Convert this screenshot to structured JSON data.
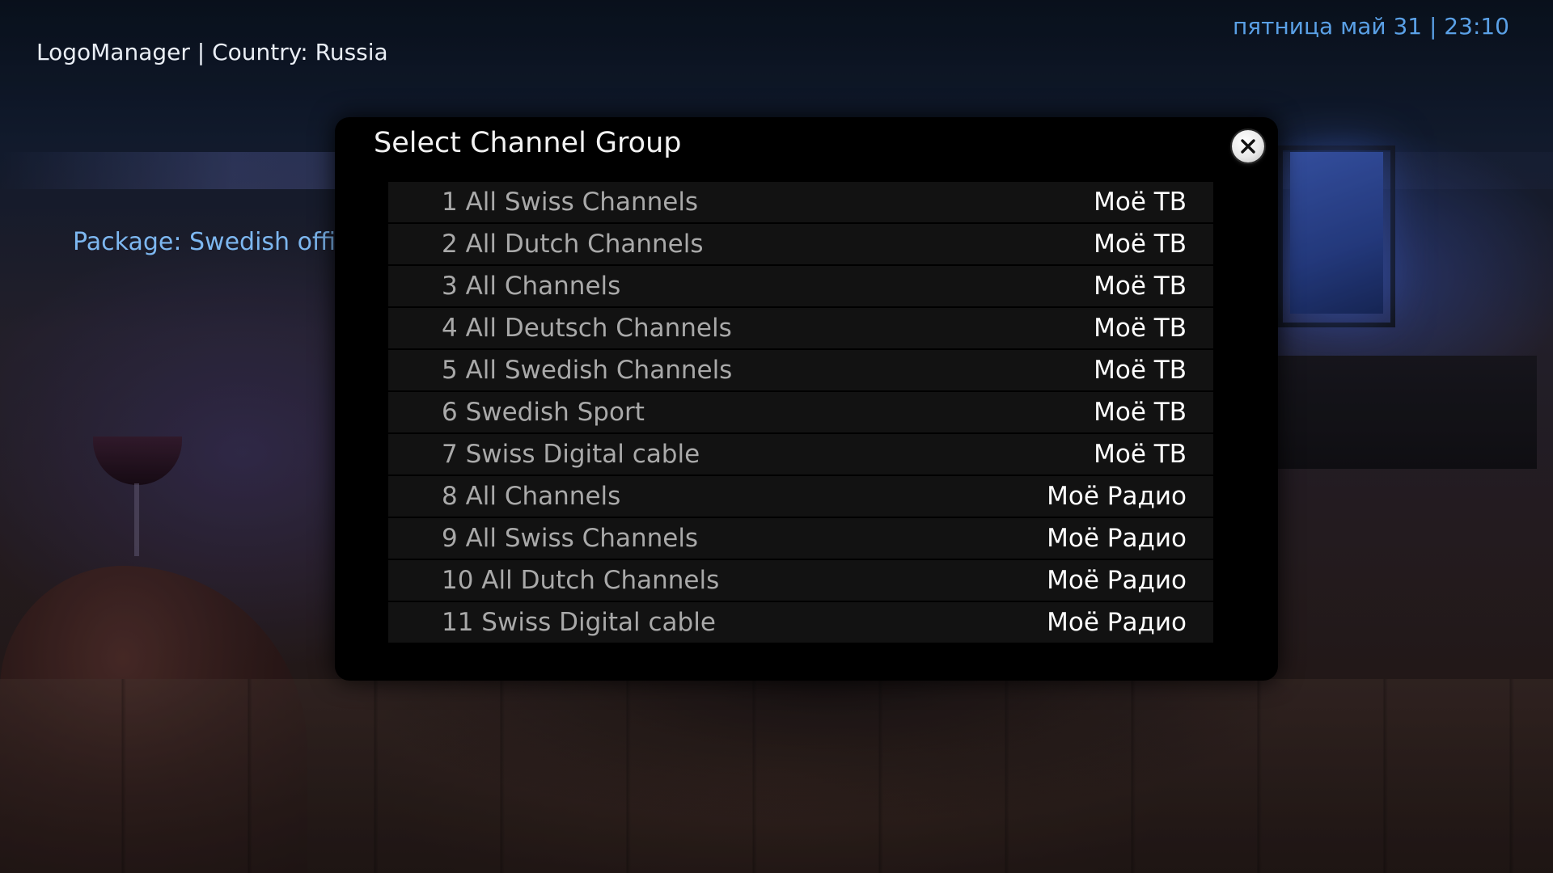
{
  "header": {
    "title": "LogoManager | Country: Russia",
    "clock": "пятница май 31 | 23:10"
  },
  "background": {
    "package_label": "Package: Swedish offic"
  },
  "dialog": {
    "title": "Select Channel Group",
    "close_icon": "close-icon",
    "items": [
      {
        "label": "1 All Swiss Channels",
        "group": "Моё ТВ"
      },
      {
        "label": "2 All Dutch Channels",
        "group": "Моё ТВ"
      },
      {
        "label": "3 All Channels",
        "group": "Моё ТВ"
      },
      {
        "label": "4 All Deutsch Channels",
        "group": "Моё ТВ"
      },
      {
        "label": "5 All Swedish Channels",
        "group": "Моё ТВ"
      },
      {
        "label": "6 Swedish Sport",
        "group": "Моё ТВ"
      },
      {
        "label": "7 Swiss Digital cable",
        "group": "Моё ТВ"
      },
      {
        "label": "8 All Channels",
        "group": "Моё Радио"
      },
      {
        "label": "9 All Swiss Channels",
        "group": "Моё Радио"
      },
      {
        "label": "10 All Dutch Channels",
        "group": "Моё Радио"
      },
      {
        "label": "11 Swiss Digital cable",
        "group": "Моё Радио"
      }
    ]
  },
  "colors": {
    "clock": "#5aa0e6",
    "package_label": "#7db7f0",
    "dialog_background": "#000000",
    "row_background": "#121212",
    "row_label": "#a9a9a9",
    "row_group": "#ffffff"
  }
}
